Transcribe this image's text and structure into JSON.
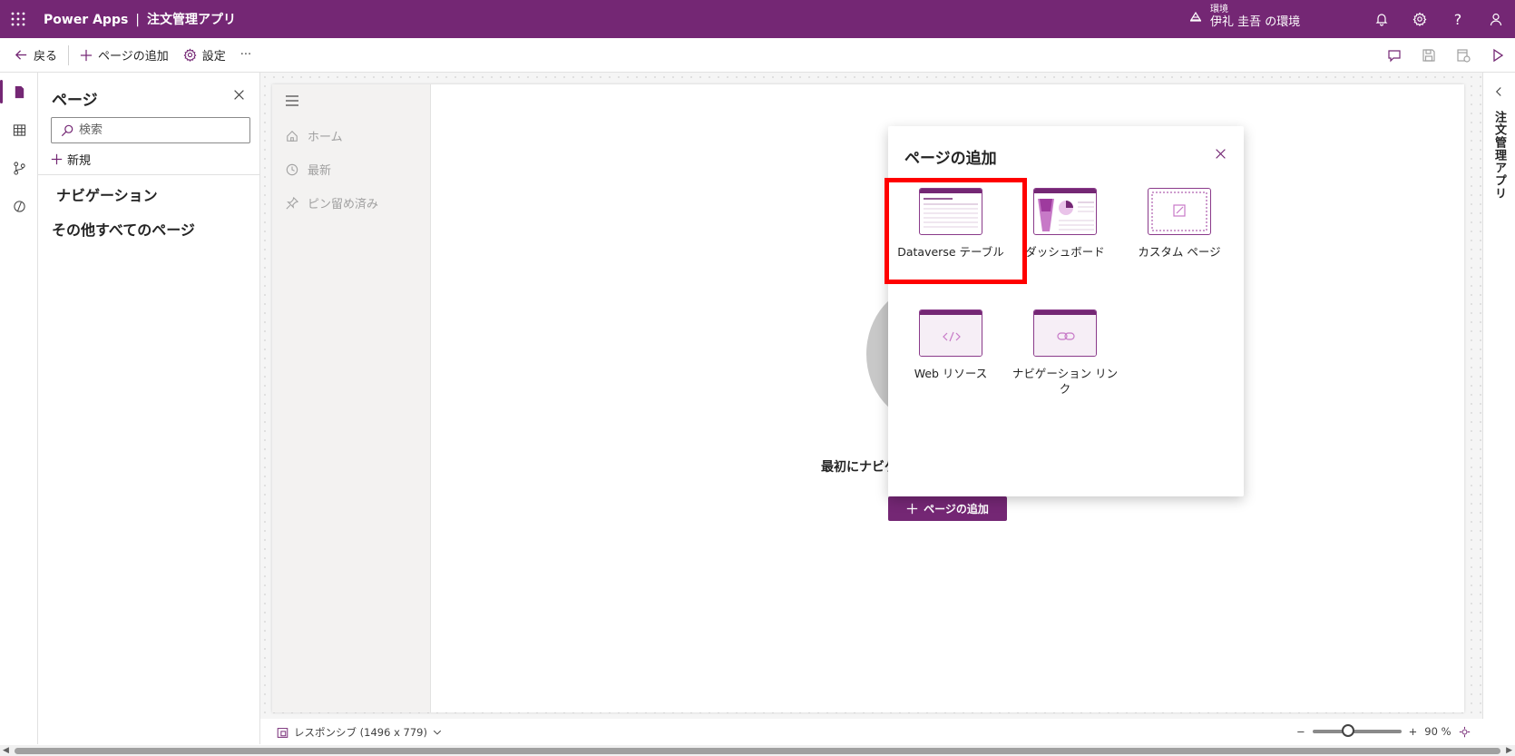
{
  "header": {
    "product": "Power Apps",
    "separator": "|",
    "app_name": "注文管理アプリ",
    "env_label": "環境",
    "env_name": "伊礼 圭吾 の環境",
    "accent": "#742774"
  },
  "command_bar": {
    "back": "戻る",
    "add_page": "ページの追加",
    "settings": "設定",
    "more": "···"
  },
  "pages_panel": {
    "title": "ページ",
    "search_placeholder": "検索",
    "new": "新規",
    "nav_heading": "ナビゲーション",
    "other_heading": "その他すべてのページ"
  },
  "app_nav": {
    "items": [
      "ホーム",
      "最新",
      "ピン留め済み"
    ]
  },
  "canvas": {
    "empty_text": "最初にナビゲ",
    "add_page_button": "ページの追加"
  },
  "dialog": {
    "title": "ページの追加",
    "tiles": [
      {
        "label": "Dataverse テーブル",
        "icon": "table-icon",
        "selected": true
      },
      {
        "label": "ダッシュボード",
        "icon": "dashboard-icon",
        "selected": false
      },
      {
        "label": "カスタム ページ",
        "icon": "custom-page-icon",
        "selected": false
      },
      {
        "label": "Web リソース",
        "icon": "code-icon",
        "selected": false
      },
      {
        "label": "ナビゲーション リンク",
        "icon": "link-icon",
        "selected": false
      }
    ],
    "highlight_color": "#ff0000"
  },
  "right_pane": {
    "title": "注文管理アプリ"
  },
  "status_bar": {
    "layout": "レスポンシブ (1496 x 779)",
    "zoom_minus": "−",
    "zoom_plus": "+",
    "zoom_value": "90 %",
    "zoom_level": 0.4
  }
}
